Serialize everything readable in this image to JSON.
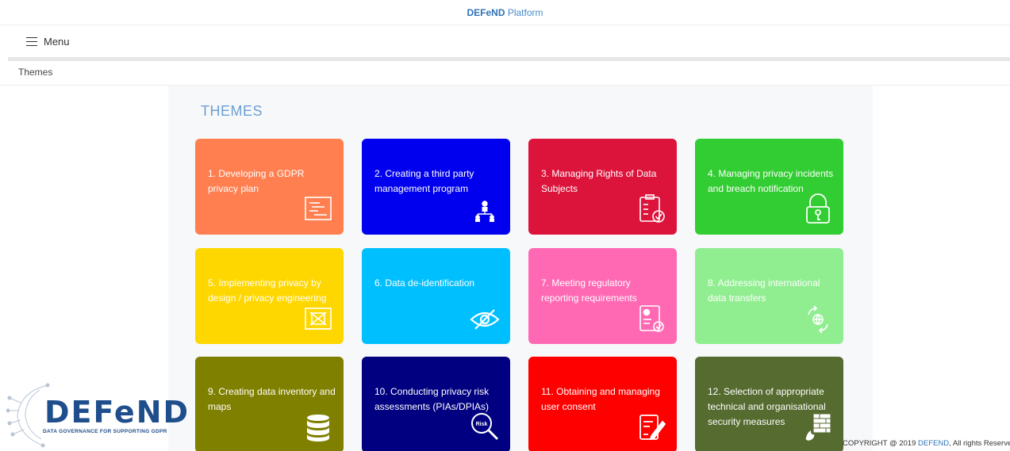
{
  "header": {
    "brand_bold": "DEFeND",
    "brand_rest": " Platform"
  },
  "menu": {
    "label": "Menu"
  },
  "breadcrumb": {
    "current": "Themes"
  },
  "main": {
    "title": "THEMES",
    "tiles": [
      {
        "label": "1. Developing a GDPR privacy plan",
        "color": "#ff7f50",
        "icon": "plan-icon"
      },
      {
        "label": "2. Creating a third party management program",
        "color": "#0000ee",
        "icon": "org-chart-icon"
      },
      {
        "label": "3. Managing Rights of Data Subjects",
        "color": "#dc143c",
        "icon": "clipboard-check-icon"
      },
      {
        "label": "4. Managing privacy incidents and breach notification",
        "color": "#32cd32",
        "icon": "padlock-icon"
      },
      {
        "label": "5. Implementing privacy by design / privacy engineering",
        "color": "#ffd700",
        "icon": "blueprint-icon"
      },
      {
        "label": "6. Data de-identification",
        "color": "#00bfff",
        "icon": "eye-slash-icon"
      },
      {
        "label": "7. Meeting regulatory reporting requirements",
        "color": "#ff69b4",
        "icon": "report-check-icon"
      },
      {
        "label": "8. Addressing international data transfers",
        "color": "#90ee90",
        "icon": "globe-transfer-icon"
      },
      {
        "label": "9. Creating data inventory and maps",
        "color": "#808000",
        "icon": "database-icon"
      },
      {
        "label": "10. Conducting privacy risk assessments (PIAs/DPIAs)",
        "color": "#000080",
        "icon": "risk-magnifier-icon",
        "icon_text": "Risk"
      },
      {
        "label": "11. Obtaining and managing user consent",
        "color": "#ff0000",
        "icon": "consent-sign-icon"
      },
      {
        "label": "12. Selection of appropriate technical and organisational security measures",
        "color": "#556b2f",
        "icon": "firewall-icon"
      }
    ]
  },
  "logo": {
    "name": "DEFeND",
    "tagline": "DATA GOVERNANCE FOR SUPPORTING GDPR"
  },
  "footer": {
    "prefix": "COPYRIGHT @ 2019 ",
    "link": "DEFEND",
    "suffix": ", All rights Reserve"
  }
}
